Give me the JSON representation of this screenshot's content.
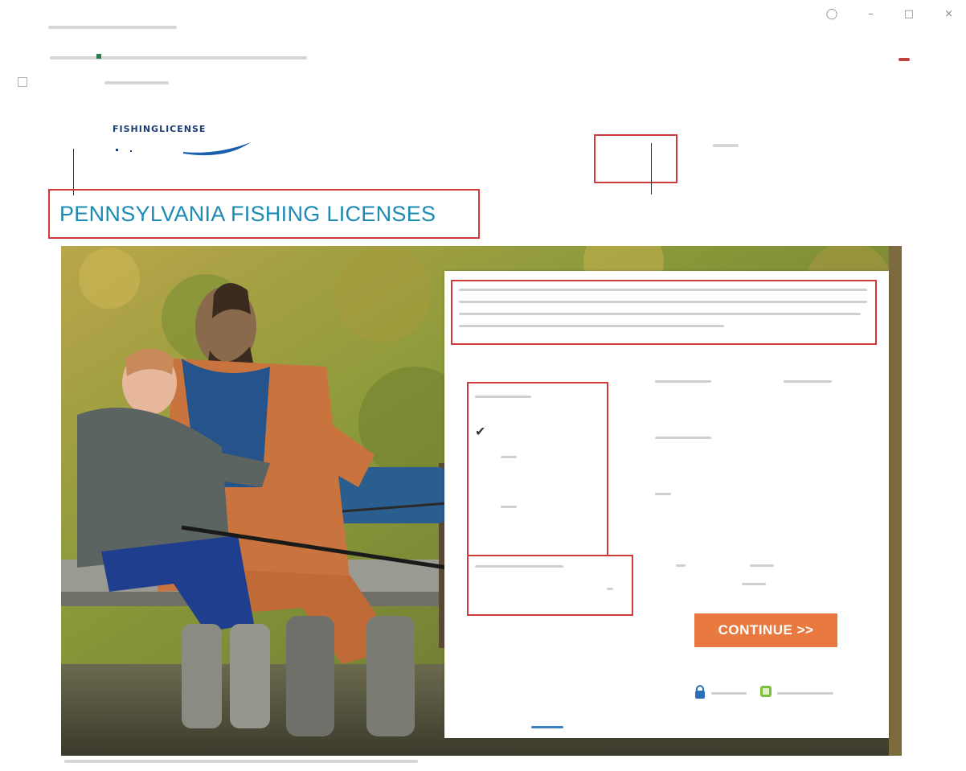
{
  "page": {
    "title": "PENNSYLVANIA FISHING LICENSES"
  },
  "logo": {
    "text": "FISHINGLICENSE"
  },
  "form": {
    "continue_label": "CONTINUE >>"
  },
  "colors": {
    "title": "#1b8bb3",
    "button": "#e8793f",
    "annotation": "#d03a3a"
  },
  "icons": {
    "window": [
      "account-icon",
      "minimize-icon",
      "maximize-icon",
      "close-icon"
    ],
    "form": [
      "check-icon",
      "lock-icon",
      "secure-badge-icon"
    ]
  }
}
